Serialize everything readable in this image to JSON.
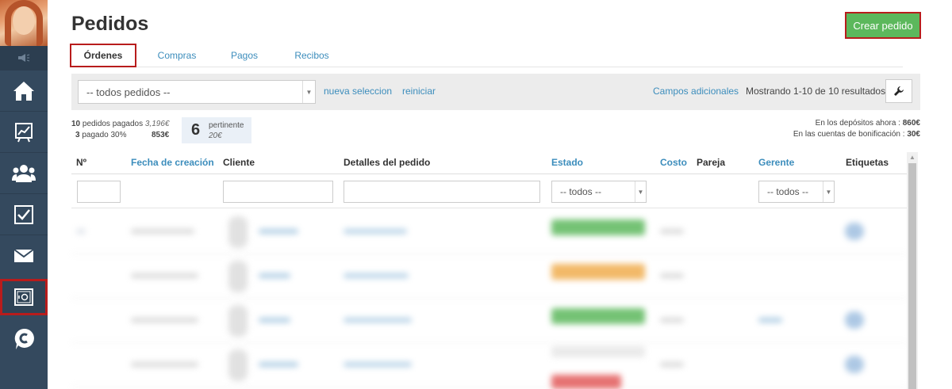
{
  "page": {
    "title": "Pedidos"
  },
  "actions": {
    "create_label": "Crear pedido"
  },
  "tabs": [
    {
      "label": "Órdenes",
      "active": true
    },
    {
      "label": "Compras"
    },
    {
      "label": "Pagos"
    },
    {
      "label": "Recibos"
    }
  ],
  "filter": {
    "select_value": "-- todos pedidos --",
    "new_selection": "nueva seleccion",
    "reset": "reiniciar",
    "additional_fields": "Campos adicionales",
    "results": "Mostrando 1-10 de 10 resultados."
  },
  "stats": {
    "paid_count": "10",
    "paid_label": "pedidos pagados",
    "paid_amount": "3,196€",
    "partial_count": "3",
    "partial_label": "pagado 30%",
    "partial_amount": "853€",
    "pertinent_count": "6",
    "pertinent_label": "pertinente",
    "pertinent_amount": "20€"
  },
  "deposits": {
    "now_label": "En los depósitos ahora :",
    "now_value": "860€",
    "bonus_label": "En las cuentas de bonificación :",
    "bonus_value": "30€"
  },
  "table": {
    "headers": {
      "num": "Nº",
      "created": "Fecha de creación",
      "client": "Cliente",
      "details": "Detalles del pedido",
      "status": "Estado",
      "cost": "Costo",
      "pair": "Pareja",
      "manager": "Gerente",
      "tags": "Etiquetas"
    },
    "status_filter": "-- todos --",
    "manager_filter": "-- todos --"
  },
  "colors": {
    "sidebar": "#34495e",
    "accent": "#3c8dbc",
    "success": "#5cb85c",
    "highlight": "#b81c1c"
  },
  "icons": [
    "speaker-icon",
    "home-icon",
    "chart-icon",
    "users-icon",
    "checkbox-icon",
    "mail-icon",
    "safe-icon",
    "chat-logo-icon",
    "wrench-icon"
  ]
}
